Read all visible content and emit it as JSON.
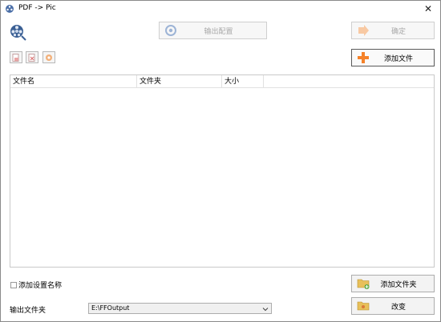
{
  "window": {
    "title": "PDF -> Pic",
    "close_label": "✕"
  },
  "toolbar": {
    "output_config_label": "输出配置",
    "confirm_label": "确定",
    "add_file_label": "添加文件"
  },
  "file_table": {
    "columns": [
      "文件名",
      "文件夹",
      "大小"
    ]
  },
  "options": {
    "add_setting_name_label": "添加设置名称",
    "add_setting_name_checked": false
  },
  "footer": {
    "add_folder_label": "添加文件夹",
    "change_label": "改变",
    "output_folder_label": "输出文件夹",
    "output_folder_value": "E:\\FFOutput"
  },
  "colors": {
    "accent_orange": "#f5822a",
    "folder_yellow": "#e8c05a",
    "disabled_text": "#a8a8a8"
  },
  "icons": {
    "title": "app-reel-icon",
    "logo": "film-reel-icon",
    "output_config": "gear-icon",
    "confirm": "arrow-right-icon",
    "add_file": "plus-icon",
    "tool_1": "file-add-icon",
    "tool_2": "file-remove-icon",
    "tool_3": "clear-icon",
    "add_folder": "folder-add-icon",
    "change": "folder-icon",
    "dropdown": "chevron-down-icon"
  }
}
